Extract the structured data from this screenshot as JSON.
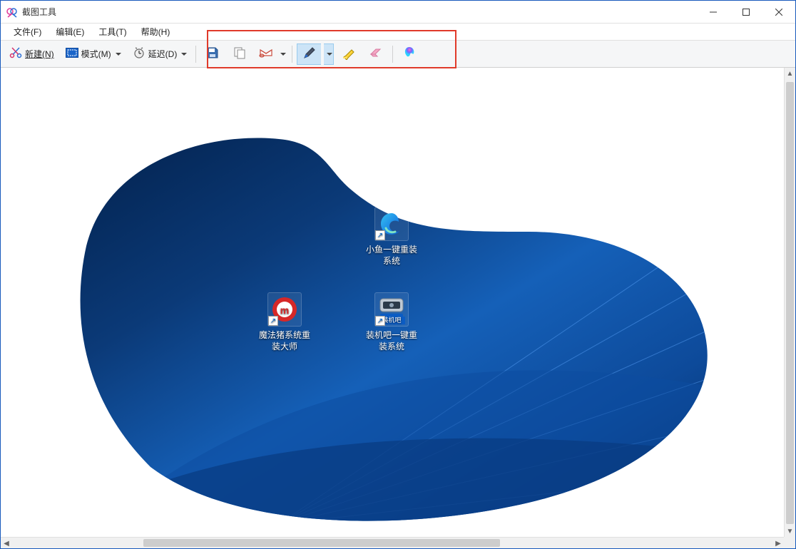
{
  "window": {
    "title": "截图工具"
  },
  "menubar": {
    "items": [
      {
        "label": "文件(F)"
      },
      {
        "label": "编辑(E)"
      },
      {
        "label": "工具(T)"
      },
      {
        "label": "帮助(H)"
      }
    ]
  },
  "toolbar": {
    "new_label": "新建(N)",
    "mode_label": "模式(M)",
    "delay_label": "延迟(D)",
    "save_icon": "save-icon",
    "copy_icon": "copy-icon",
    "send_icon": "send-icon",
    "pen_icon": "pen-icon",
    "highlighter_icon": "highlighter-icon",
    "eraser_icon": "eraser-icon",
    "paint3d_icon": "paint3d-icon"
  },
  "snip": {
    "desktop_icons": [
      {
        "id": "edge",
        "label_line1": "小鱼一键重装",
        "label_line2": "系统"
      },
      {
        "id": "mofa",
        "label_line1": "魔法猪系统重",
        "label_line2": "装大师"
      },
      {
        "id": "zhuangji",
        "label_line1": "装机吧一键重",
        "label_line2": "装系统",
        "badge": "装机吧"
      }
    ]
  },
  "annotation": {
    "highlight": "toolbar-edit-tools"
  }
}
